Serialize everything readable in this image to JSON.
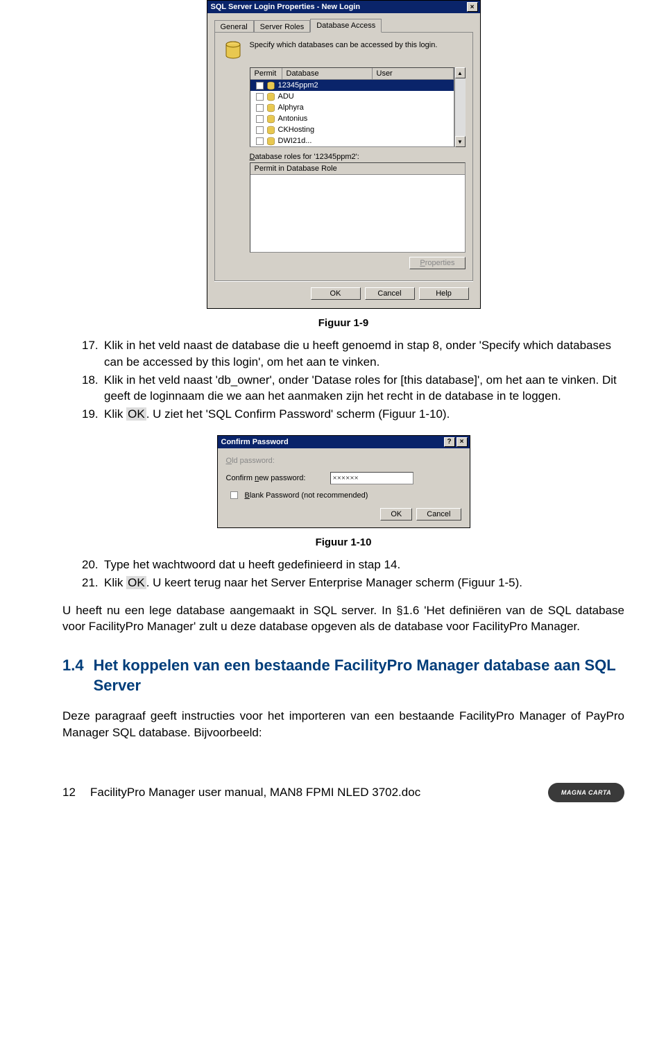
{
  "dialog1": {
    "title": "SQL Server Login Properties - New Login",
    "tabs": [
      "General",
      "Server Roles",
      "Database Access"
    ],
    "active_tab_index": 2,
    "instruction": "Specify which databases can be accessed by this login.",
    "columns": {
      "permit": "Permit",
      "database": "Database",
      "user": "User"
    },
    "rows": [
      {
        "name": "12345ppm2",
        "selected": true
      },
      {
        "name": "ADU"
      },
      {
        "name": "Alphyra"
      },
      {
        "name": "Antonius"
      },
      {
        "name": "CKHosting"
      },
      {
        "name": "DWI21d..."
      }
    ],
    "roles_label": "Database roles for '12345ppm2':",
    "roles_header": "Permit in Database Role",
    "properties_btn": "Properties",
    "ok": "OK",
    "cancel": "Cancel",
    "help": "Help"
  },
  "fig1_caption": "Figuur 1-9",
  "steps_a": [
    {
      "n": "17.",
      "t": "Klik in het veld naast de database die u heeft genoemd in stap 8, onder 'Specify which databases can be accessed by this login', om het aan te vinken."
    },
    {
      "n": "18.",
      "t": "Klik in het veld naast 'db_owner', onder 'Datase roles for [this database]', om het aan te vinken. Dit geeft de loginnaam die we aan het aanmaken zijn het recht in de database in te loggen."
    },
    {
      "n": "19.",
      "t_pre": "Klik ",
      "hl": "OK",
      "t_post": ". U ziet het 'SQL Confirm Password' scherm (Figuur 1-10)."
    }
  ],
  "dialog2": {
    "title": "Confirm Password",
    "old_pwd_label": "Old password:",
    "confirm_label_pre": "Confirm ",
    "confirm_label_u": "n",
    "confirm_label_post": "ew password:",
    "confirm_value": "××××××",
    "blank_u": "B",
    "blank_rest": "lank Password (not recommended)",
    "ok": "OK",
    "cancel": "Cancel"
  },
  "fig2_caption": "Figuur 1-10",
  "steps_b": [
    {
      "n": "20.",
      "t": "Type het wachtwoord dat u heeft gedefinieerd in stap 14."
    },
    {
      "n": "21.",
      "t_pre": "Klik ",
      "hl": "OK",
      "t_post": ". U keert terug naar het Server Enterprise Manager scherm (Figuur 1-5)."
    }
  ],
  "paragraph": "U heeft nu een lege database aangemaakt in SQL server. In §1.6 'Het definiëren van de SQL database voor FacilityPro Manager' zult u deze database opgeven als de database voor FacilityPro Manager.",
  "section": {
    "number": "1.4",
    "title": "Het koppelen van een bestaande FacilityPro Manager database aan SQL Server"
  },
  "section_body": "Deze paragraaf geeft instructies voor het importeren van een bestaande FacilityPro Manager of PayPro Manager SQL database. Bijvoorbeeld:",
  "footer": {
    "page": "12",
    "doc": "FacilityPro Manager user manual, MAN8 FPMI NLED 3702.doc",
    "logo": "MAGNA CARTA"
  }
}
